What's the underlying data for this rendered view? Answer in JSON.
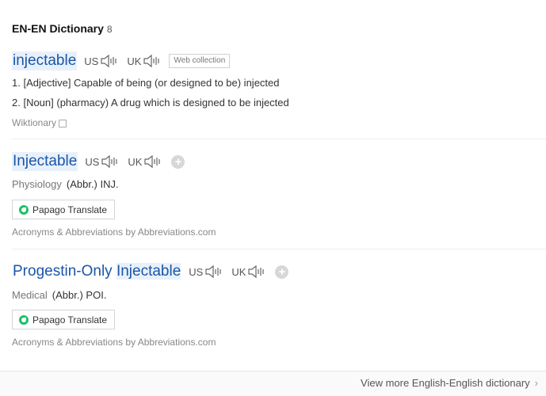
{
  "section": {
    "title": "EN-EN Dictionary",
    "count": "8"
  },
  "entry1": {
    "headword": "injectable",
    "us_label": "US",
    "uk_label": "UK",
    "tag": "Web collection",
    "defs": [
      "1. [Adjective] Capable of being (or designed to be) injected",
      "2. [Noun] (pharmacy) A drug which is designed to be injected"
    ],
    "source": "Wiktionary"
  },
  "entry2": {
    "headword": "Injectable",
    "us_label": "US",
    "uk_label": "UK",
    "field": "Physiology",
    "meaning": "(Abbr.) INJ.",
    "papago_label": "Papago Translate",
    "source": "Acronyms & Abbreviations by Abbreviations.com"
  },
  "entry3": {
    "headword_prefix": "Progestin-Only ",
    "headword_hl": "Injectable",
    "us_label": "US",
    "uk_label": "UK",
    "field": "Medical",
    "meaning": "(Abbr.) POI.",
    "papago_label": "Papago Translate",
    "source": "Acronyms & Abbreviations by Abbreviations.com"
  },
  "footer": {
    "more_label": "View more English-English dictionary",
    "chevron": "›"
  },
  "icons": {
    "plus": "+"
  }
}
